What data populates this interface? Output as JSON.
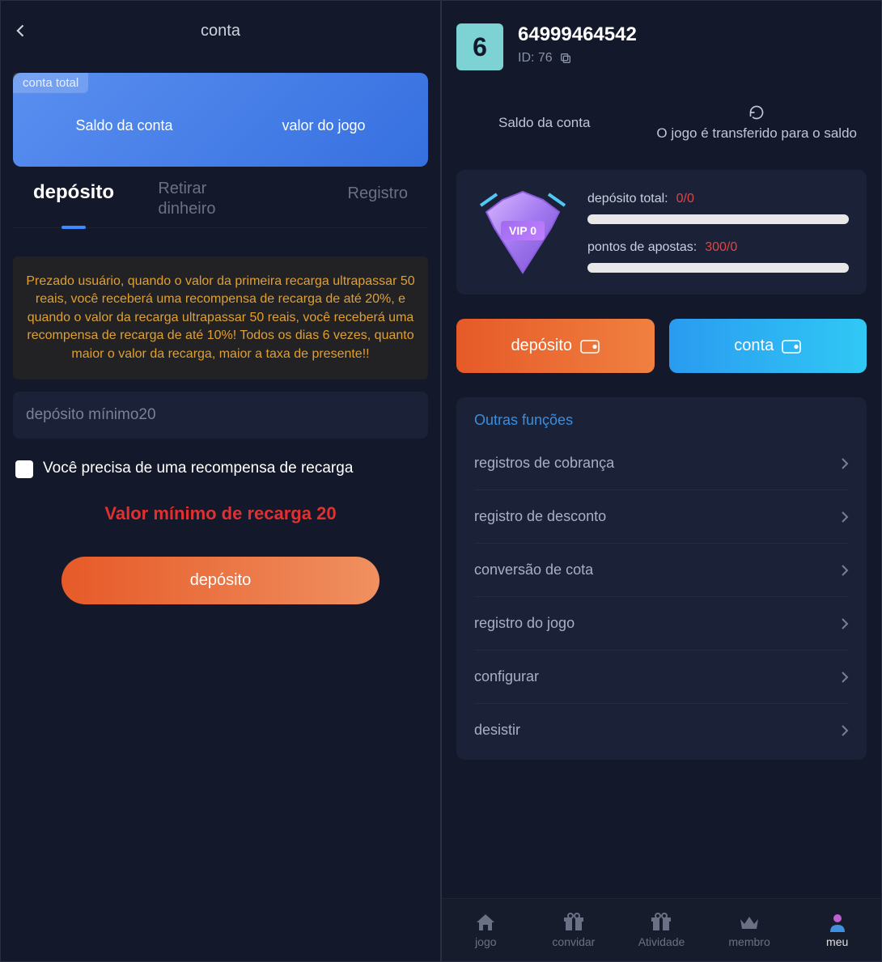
{
  "left": {
    "header_title": "conta",
    "balance": {
      "tag": "conta total",
      "col1": "Saldo da conta",
      "col2": "valor do jogo"
    },
    "tabs": {
      "deposit": "depósito",
      "withdraw_l1": "Retirar",
      "withdraw_l2": "dinheiro",
      "register": "Registro"
    },
    "promo": "Prezado usuário, quando o valor da primeira recarga ultrapassar 50 reais, você receberá uma recompensa de recarga de até 20%, e quando o valor da recarga ultrapassar 50 reais, você receberá uma recompensa de recarga de até 10%! Todos os dias 6 vezes, quanto maior o valor da recarga, maior a taxa de presente!!",
    "amount_placeholder": "depósito mínimo20",
    "reward_checkbox": "Você precisa de uma recompensa de recarga",
    "min_warning": "Valor mínimo de recarga 20",
    "deposit_btn": "depósito"
  },
  "right": {
    "avatar_digit": "6",
    "username": "64999464542",
    "id_label": "ID: 76",
    "balance_label": "Saldo da conta",
    "transfer_label": "O jogo é transferido para o saldo",
    "vip": {
      "badge": "VIP 0",
      "deposit_key": "depósito total:",
      "deposit_val": "0/0",
      "points_key": "pontos de apostas:",
      "points_val": "300/0"
    },
    "buttons": {
      "deposit": "depósito",
      "account": "conta"
    },
    "functions": {
      "title": "Outras funções",
      "items": [
        "registros de cobrança",
        "registro de desconto",
        "conversão de cota",
        "registro do jogo",
        "configurar",
        "desistir"
      ]
    },
    "nav": {
      "game": "jogo",
      "invite": "convidar",
      "activity": "Atividade",
      "member": "membro",
      "mine": "meu"
    }
  }
}
